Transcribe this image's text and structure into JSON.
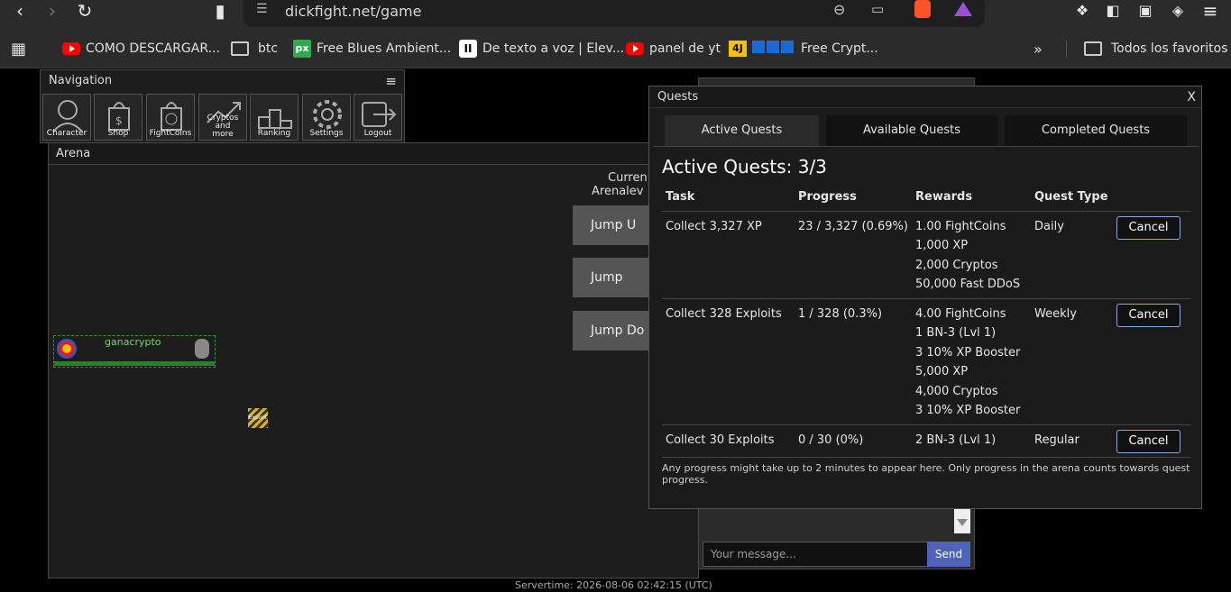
{
  "browser": {
    "url": "dickfight.net/game",
    "bookmarks": [
      {
        "label": "COMO DESCARGAR...",
        "icon": "youtube-icon"
      },
      {
        "label": "btc",
        "icon": "folder-icon"
      },
      {
        "label": "Free Blues Ambient...",
        "icon": "pixabay-icon"
      },
      {
        "label": "De texto a voz | Elev...",
        "icon": "elevenlabs-icon"
      },
      {
        "label": "panel de yt",
        "icon": "youtube-icon"
      },
      {
        "label": "Free Crypt...",
        "icon": "crypto-icon"
      }
    ],
    "all_bookmarks": "Todos los favoritos"
  },
  "navigation": {
    "title": "Navigation",
    "buttons": [
      "Character",
      "Shop",
      "FightCoins",
      "Cryptos and more",
      "Ranking",
      "Settings",
      "Logout"
    ]
  },
  "arena": {
    "title": "Arena",
    "current_label": "Curren",
    "arenalevel_label": "Arenalev",
    "jump_up": "Jump U",
    "jump": "Jump",
    "jump_down": "Jump Do",
    "player_name": "ganacrypto",
    "item_label": "Exploit"
  },
  "quests": {
    "header": "Quests",
    "close": "X",
    "tabs": [
      "Active Quests",
      "Available Quests",
      "Completed Quests"
    ],
    "active_title": "Active Quests: 3/3",
    "columns": [
      "Task",
      "Progress",
      "Rewards",
      "Quest Type"
    ],
    "rows": [
      {
        "task": "Collect 3,327 XP",
        "progress": "23 / 3,327 (0.69%)",
        "rewards": [
          "1.00 FightCoins",
          "1,000 XP",
          "2,000 Cryptos",
          "50,000 Fast DDoS"
        ],
        "type": "Daily",
        "cancel": "Cancel"
      },
      {
        "task": "Collect 328 Exploits",
        "progress": "1 / 328 (0.3%)",
        "rewards": [
          "4.00 FightCoins",
          "1 BN-3 (Lvl 1)",
          "3 10% XP Booster",
          "5,000 XP",
          "4,000 Cryptos",
          "3 10% XP Booster"
        ],
        "type": "Weekly",
        "cancel": "Cancel"
      },
      {
        "task": "Collect 30 Exploits",
        "progress": "0 / 30 (0%)",
        "rewards": [
          "2 BN-3 (Lvl 1)"
        ],
        "type": "Regular",
        "cancel": "Cancel"
      }
    ],
    "note": "Any progress might take up to 2 minutes to appear here. Only progress in the arena counts towards quest progress."
  },
  "chat": {
    "placeholder": "Your message...",
    "send": "Send"
  },
  "servertime": "Servertime: 2026-08-06 02:42:15 (UTC)"
}
